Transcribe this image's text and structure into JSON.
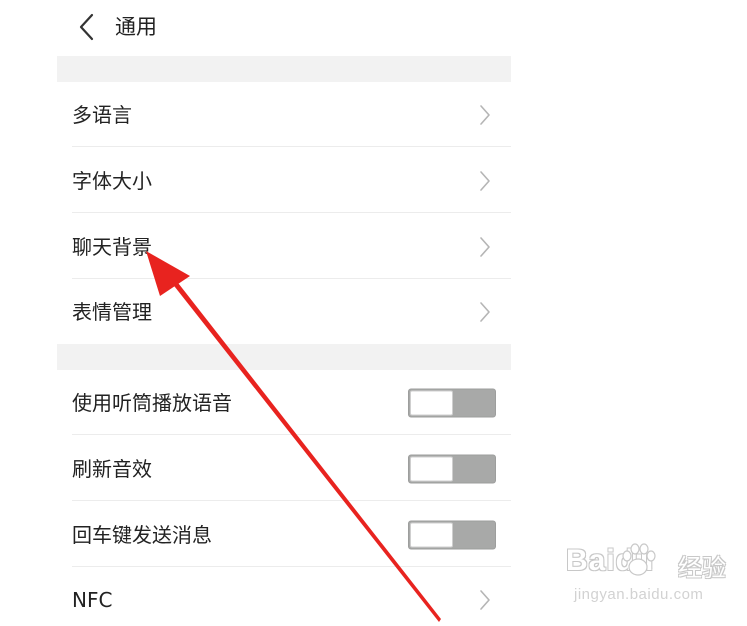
{
  "header": {
    "title": "通用",
    "back_icon": "chevron-left-icon"
  },
  "group1": {
    "items": [
      {
        "label": "多语言",
        "icon": "chevron-right-icon"
      },
      {
        "label": "字体大小",
        "icon": "chevron-right-icon"
      },
      {
        "label": "聊天背景",
        "icon": "chevron-right-icon"
      },
      {
        "label": "表情管理",
        "icon": "chevron-right-icon"
      }
    ]
  },
  "group2": {
    "items": [
      {
        "label": "使用听筒播放语音",
        "toggle": "off"
      },
      {
        "label": "刷新音效",
        "toggle": "off"
      },
      {
        "label": "回车键发送消息",
        "toggle": "off"
      },
      {
        "label": "NFC",
        "icon": "chevron-right-icon"
      }
    ]
  },
  "annotation": {
    "type": "red-arrow",
    "color": "#e8231f",
    "points_to": "聊天背景"
  },
  "watermark": {
    "main": "Baidu",
    "suffix": "经验",
    "sub": "jingyan.baidu.com"
  },
  "colors": {
    "background": "#ffffff",
    "section_gap": "#f2f2f2",
    "toggle_track": "#a8a9a8",
    "chevron": "#b5b5b5",
    "text": "#222222"
  }
}
